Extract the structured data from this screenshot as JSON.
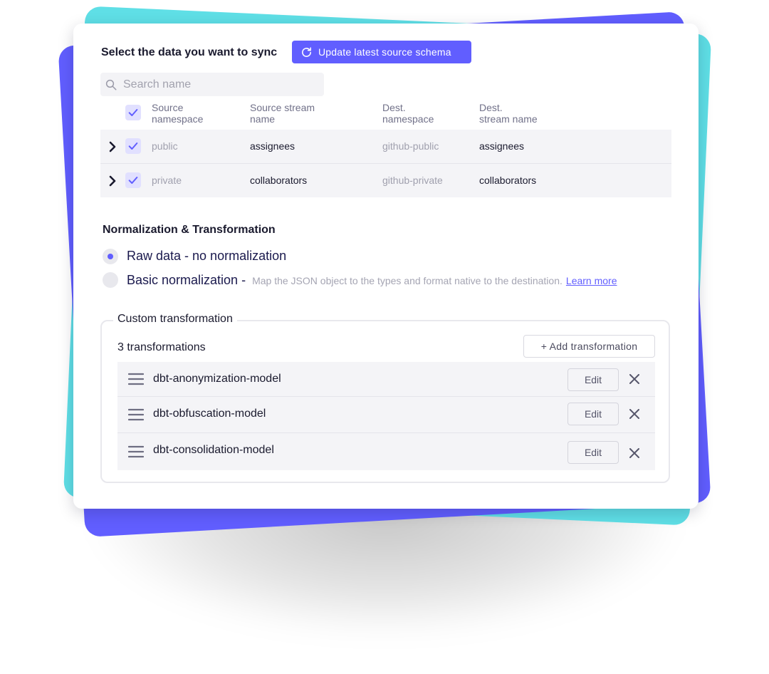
{
  "colors": {
    "accent": "#615eff",
    "teal_card": "#5fdfe6",
    "purple_card": "#615eff",
    "row_background": "#f4f4f7"
  },
  "sync": {
    "title": "Select the data you want to sync",
    "update_button_label": "Update latest source schema",
    "update_icon": "refresh-icon",
    "search_placeholder": "Search name",
    "search_value": ""
  },
  "table": {
    "headers": {
      "source_namespace": "Source\nnamespace",
      "source_stream_name": "Source stream\nname",
      "dest_namespace": "Dest.\nnamespace",
      "dest_stream_name": "Dest.\nstream name"
    },
    "select_all_checked": true,
    "rows": [
      {
        "checked": true,
        "source_namespace": "public",
        "source_stream_name": "assignees",
        "dest_namespace": "github-public",
        "dest_stream_name": "assignees"
      },
      {
        "checked": true,
        "source_namespace": "private",
        "source_stream_name": "collaborators",
        "dest_namespace": "github-private",
        "dest_stream_name": "collaborators"
      }
    ]
  },
  "normalization": {
    "title": "Normalization & Transformation",
    "selected": "raw",
    "options": {
      "raw": {
        "label": "Raw data - no normalization"
      },
      "basic": {
        "label": "Basic normalization - ",
        "description": "Map the JSON object to the types and format native to the destination.",
        "link": "Learn more"
      }
    }
  },
  "custom_transformation": {
    "legend": "Custom transformation",
    "count_label": "3 transformations",
    "add_button_label": "+ Add transformation",
    "edit_label": "Edit",
    "items": [
      {
        "name": "dbt-anonymization-model"
      },
      {
        "name": "dbt-obfuscation-model"
      },
      {
        "name": "dbt-consolidation-model"
      }
    ]
  }
}
